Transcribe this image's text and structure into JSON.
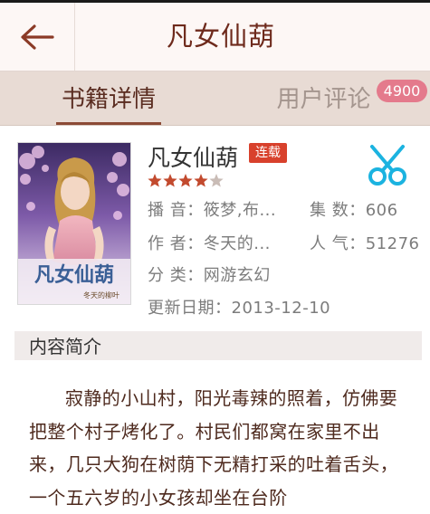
{
  "header": {
    "title": "凡女仙葫"
  },
  "tabs": {
    "detail": "书籍详情",
    "reviews": "用户评论",
    "review_count": "4900"
  },
  "book": {
    "title": "凡女仙葫",
    "serial_badge": "连载",
    "rating": 4.5,
    "cover_text": "凡女仙葫",
    "cover_signature": "冬天的柳叶"
  },
  "info": {
    "narrator": "播  音：筱梦,布...",
    "episodes": "集  数：606",
    "author": "作  者：冬天的...",
    "popularity": "人  气：51276",
    "category": "分  类：网游玄幻",
    "updated": "更新日期：2013-12-10"
  },
  "intro": {
    "title": "内容简介",
    "text": "寂静的小山村，阳光毒辣的照着，仿佛要把整个村子烤化了。村民们都窝在家里不出来，几只大狗在树荫下无精打采的吐着舌头，一个五六岁的小女孩却坐在台阶"
  },
  "colors": {
    "accent": "#6e2a1c",
    "badge": "#e47a8c",
    "serial": "#d8412c",
    "star": "#c24a2e",
    "share": "#1bb3e0"
  },
  "icons": {
    "back": "back-arrow-icon",
    "share": "scissors-share-icon",
    "star": "star-icon"
  }
}
